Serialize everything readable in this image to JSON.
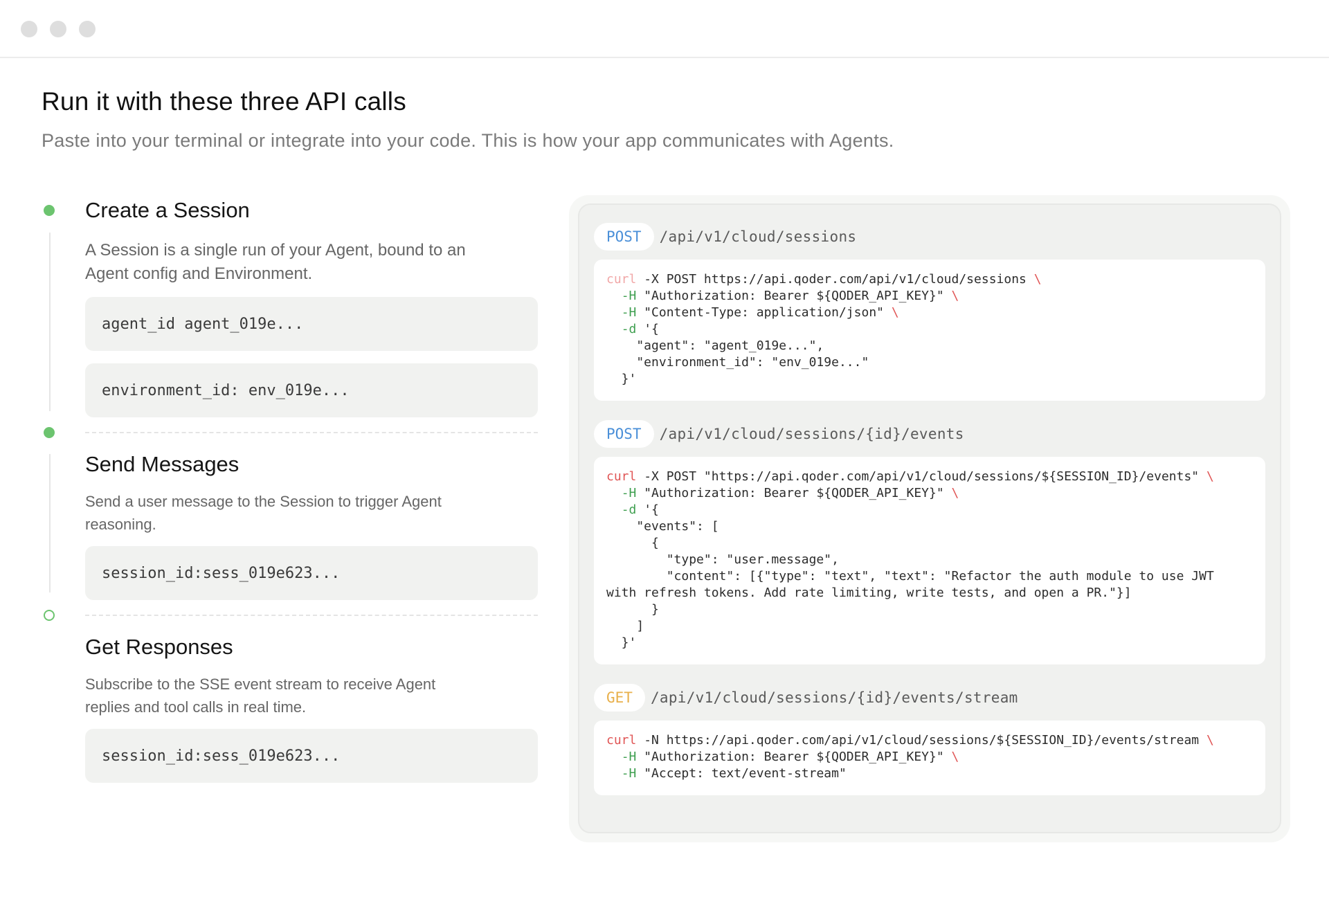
{
  "window": {
    "controls": [
      "close-dot",
      "minimize-dot",
      "zoom-dot"
    ]
  },
  "page": {
    "title": "Run it with these three API calls",
    "subtitle": "Paste into your terminal or integrate into your code. This is how your app communicates with Agents."
  },
  "steps": [
    {
      "title": "Create a Session",
      "description": "A Session is a single run of your Agent, bound to an Agent config and Environment.",
      "fields": [
        "agent_id agent_019e...",
        "environment_id: env_019e..."
      ],
      "status": "done"
    },
    {
      "title": "Send Messages",
      "description": "Send a user message to the Session to trigger Agent reasoning.",
      "fields": [
        "session_id:sess_019e623..."
      ],
      "status": "done"
    },
    {
      "title": "Get Responses",
      "description": "Subscribe to the SSE event stream to receive Agent replies and tool calls in real time.",
      "fields": [
        "session_id:sess_019e623..."
      ],
      "status": "pending"
    }
  ],
  "colors": {
    "step_done": "#6cc46f",
    "method_post": "#4a8fd8",
    "method_get": "#e8b04b",
    "code_command": "#e05555",
    "code_flag": "#3f9f50"
  },
  "endpoints": [
    {
      "method": "POST",
      "path": "/api/v1/cloud/sessions",
      "code": [
        [
          {
            "t": "curl",
            "c": "cmd-faded"
          },
          {
            "t": " -X POST https://api.qoder.com/api/v1/cloud/sessions "
          },
          {
            "t": "\\",
            "c": "bs"
          }
        ],
        [
          {
            "t": "  "
          },
          {
            "t": "-H",
            "c": "flag"
          },
          {
            "t": " \"Authorization: Bearer ${QODER_API_KEY}\" "
          },
          {
            "t": "\\",
            "c": "bs"
          }
        ],
        [
          {
            "t": "  "
          },
          {
            "t": "-H",
            "c": "flag"
          },
          {
            "t": " \"Content-Type: application/json\" "
          },
          {
            "t": "\\",
            "c": "bs"
          }
        ],
        [
          {
            "t": "  "
          },
          {
            "t": "-d",
            "c": "flag"
          },
          {
            "t": " '{"
          }
        ],
        [
          {
            "t": "    \"agent\": \"agent_019e...\","
          }
        ],
        [
          {
            "t": "    \"environment_id\": \"env_019e...\""
          }
        ],
        [
          {
            "t": "  }'"
          }
        ]
      ]
    },
    {
      "method": "POST",
      "path": "/api/v1/cloud/sessions/{id}/events",
      "code": [
        [
          {
            "t": "curl",
            "c": "cmd"
          },
          {
            "t": " -X POST \"https://api.qoder.com/api/v1/cloud/sessions/${SESSION_ID}/events\" "
          },
          {
            "t": "\\",
            "c": "bs"
          }
        ],
        [
          {
            "t": "  "
          },
          {
            "t": "-H",
            "c": "flag"
          },
          {
            "t": " \"Authorization: Bearer ${QODER_API_KEY}\" "
          },
          {
            "t": "\\",
            "c": "bs"
          }
        ],
        [
          {
            "t": "  "
          },
          {
            "t": "-d",
            "c": "flag"
          },
          {
            "t": " '{"
          }
        ],
        [
          {
            "t": "    \"events\": ["
          }
        ],
        [
          {
            "t": "      {"
          }
        ],
        [
          {
            "t": "        \"type\": \"user.message\","
          }
        ],
        [
          {
            "t": "        \"content\": [{\"type\": \"text\", \"text\": \"Refactor the auth module to use JWT"
          }
        ],
        [
          {
            "t": "with refresh tokens. Add rate limiting, write tests, and open a PR.\"}]"
          }
        ],
        [
          {
            "t": "      }"
          }
        ],
        [
          {
            "t": "    ]"
          }
        ],
        [
          {
            "t": "  }'"
          }
        ]
      ]
    },
    {
      "method": "GET",
      "path": "/api/v1/cloud/sessions/{id}/events/stream",
      "code": [
        [
          {
            "t": "curl",
            "c": "cmd"
          },
          {
            "t": " -N https://api.qoder.com/api/v1/cloud/sessions/${SESSION_ID}/events/stream "
          },
          {
            "t": "\\",
            "c": "bs"
          }
        ],
        [
          {
            "t": "  "
          },
          {
            "t": "-H",
            "c": "flag"
          },
          {
            "t": " \"Authorization: Bearer ${QODER_API_KEY}\" "
          },
          {
            "t": "\\",
            "c": "bs"
          }
        ],
        [
          {
            "t": "  "
          },
          {
            "t": "-H",
            "c": "flag"
          },
          {
            "t": " \"Accept: text/event-stream\""
          }
        ]
      ]
    }
  ]
}
